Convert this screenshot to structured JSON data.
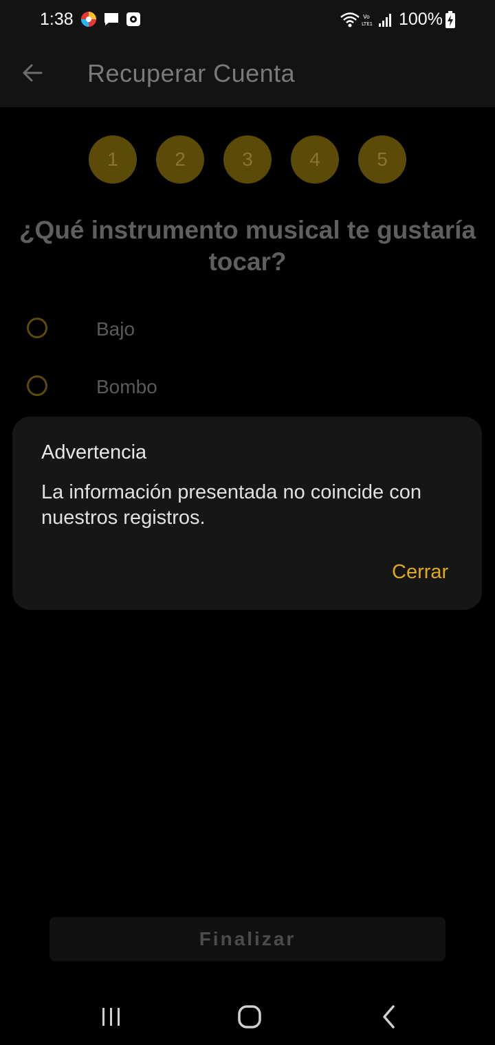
{
  "status_bar": {
    "time": "1:38",
    "battery": "100%",
    "icons": [
      "app-notification-icon",
      "message-icon",
      "camera-app-icon",
      "wifi-icon",
      "volte-icon",
      "signal-icon",
      "battery-charging-icon"
    ]
  },
  "app_bar": {
    "title": "Recuperar Cuenta",
    "back_icon": "arrow-left-icon"
  },
  "steps": [
    "1",
    "2",
    "3",
    "4",
    "5"
  ],
  "question": {
    "title": "¿Qué instrumento musical te gustaría tocar?",
    "options": [
      "Bajo",
      "Bombo"
    ]
  },
  "dialog": {
    "title": "Advertencia",
    "message": "La información presentada no coincide con nuestros registros.",
    "close_label": "Cerrar"
  },
  "footer": {
    "finish_label": "Finalizar"
  },
  "colors": {
    "accent": "#e0a81d",
    "step_fill": "#5c4a08",
    "background": "#000000",
    "dialog_bg": "#161616"
  }
}
